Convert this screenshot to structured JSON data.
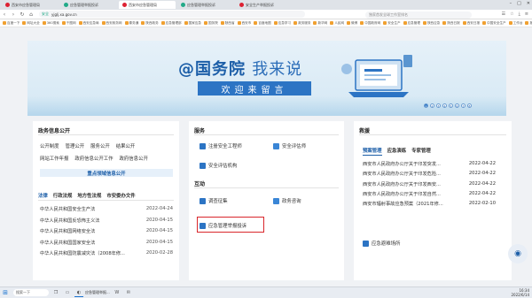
{
  "browser": {
    "tabs": [
      {
        "title": "西安市应急管理局",
        "active": false
      },
      {
        "title": "应急管理举报投诉",
        "active": false
      },
      {
        "title": "西安市应急管理局",
        "active": true
      },
      {
        "title": "应急管理举报投诉",
        "active": false
      },
      {
        "title": "安全生产举报投诉",
        "active": false
      }
    ],
    "url": "yjglj.xa.gov.cn",
    "secure_label": "安全",
    "search_placeholder": "独家首发全球工作室排名"
  },
  "bookmarks": [
    "百度一下",
    "网址大全",
    "360搜索",
    "千图网",
    "西安应急局",
    "西安政务网",
    "秦务通",
    "陕西政务",
    "应急管理部",
    "国家应急",
    "国务院",
    "陕西省",
    "西安市",
    "百度地图",
    "应急学习",
    "政务服务",
    "新华网",
    "人民网",
    "微博",
    "中国政府网",
    "安全生产",
    "应急管理",
    "陕西应急",
    "陕西日报",
    "西安日报",
    "中国安全生产",
    "工作台",
    "报告",
    "学习",
    "其他收藏"
  ],
  "banner": {
    "title": "@国务院",
    "title_suffix": "我来说",
    "subtitle": "欢迎来留言",
    "pages": [
      "1",
      "2",
      "3",
      "4",
      "5",
      "6",
      "7",
      "8"
    ]
  },
  "gov_info": {
    "heading": "政务信息公开",
    "links_row1": [
      "公开制度",
      "管理公开",
      "服务公开",
      "结果公开"
    ],
    "links_row2": [
      "网站工作年报",
      "政府信息公开工作",
      "政府信息公开"
    ],
    "key_button": "重点领域信息公开",
    "sub_tabs": [
      "法律",
      "行政法规",
      "地方性法规",
      "市安委办文件"
    ],
    "laws": [
      {
        "title": "中华人民共和国安全生产法",
        "date": "2022-04-24"
      },
      {
        "title": "中华人民共和国反恐怖主义法",
        "date": "2020-04-15"
      },
      {
        "title": "中华人民共和国网络安全法",
        "date": "2020-04-15"
      },
      {
        "title": "中华人民共和国国家安全法",
        "date": "2020-04-15"
      },
      {
        "title": "中华人民共和国防震减灾法（2008年修...",
        "date": "2020-02-28"
      }
    ]
  },
  "services": {
    "heading": "服务",
    "items": [
      "注册安全工程师",
      "安全评估师",
      "安全评估机构"
    ],
    "interaction_heading": "互动",
    "interaction_items": [
      "调查征集",
      "政务咨询",
      "应急管理举报投诉"
    ]
  },
  "emergency": {
    "heading": "救援",
    "tabs": [
      "预案管理",
      "应急演练",
      "专家管理"
    ],
    "items": [
      {
        "title": "西安市人民政府办公厅关于印发突发...",
        "date": "2022-04-22"
      },
      {
        "title": "西安市人民政府办公厅关于印发危险...",
        "date": "2022-04-22"
      },
      {
        "title": "西安市人民政府办公厅关于印发西安...",
        "date": "2022-04-22"
      },
      {
        "title": "西安市人民政府办公厅关于印发自然...",
        "date": "2022-04-22"
      },
      {
        "title": "西安市辐射事故应急预案（2021年修...",
        "date": "2022-02-10"
      }
    ],
    "shelter": "应急避难场所"
  },
  "taskbar": {
    "search": "搜索一下",
    "active_window": "应急管理举报...",
    "time": "16:34",
    "date": "2022/6/14"
  },
  "colors": {
    "accent": "#1c5ea8",
    "highlight": "#d9262b",
    "banner": "#2c74c4"
  }
}
